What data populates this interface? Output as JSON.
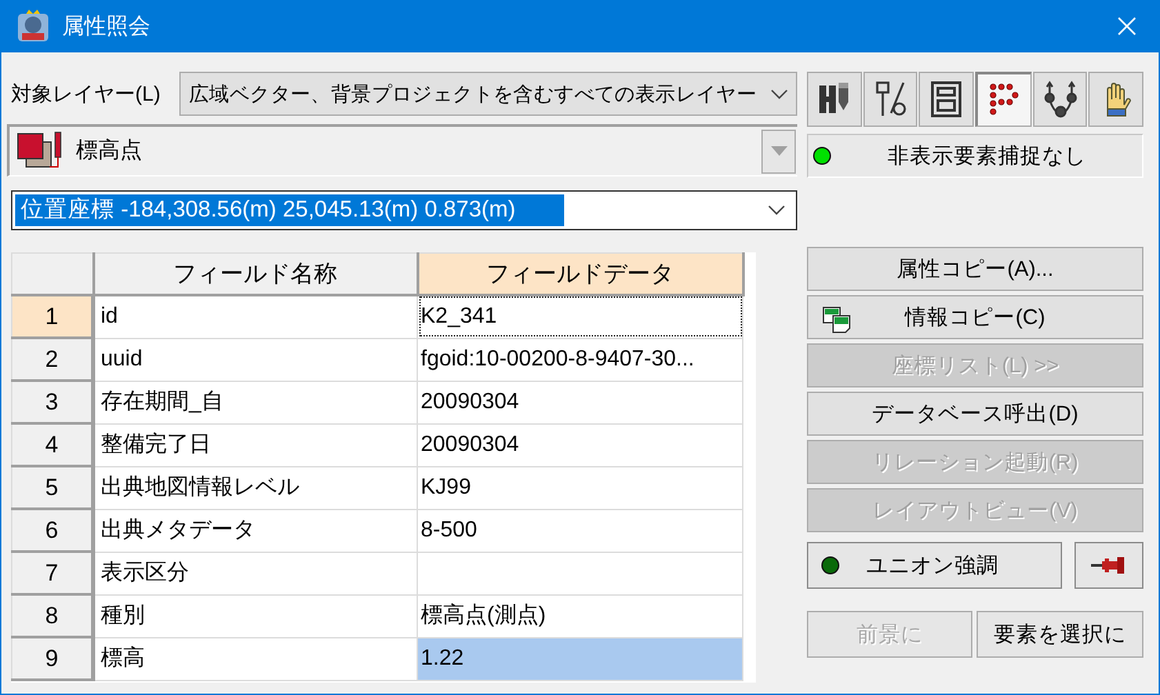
{
  "window": {
    "title": "属性照会"
  },
  "target_layer": {
    "label": "対象レイヤー(L)",
    "value": "広域ベクター、背景プロジェクトを含むすべての表示レイヤー"
  },
  "layer": {
    "name": "標高点",
    "dropdown_disabled": true
  },
  "position": {
    "value": "位置座標 -184,308.56(m) 25,045.13(m) 0.873(m)",
    "selected": true
  },
  "tools": [
    {
      "kind": "pencil",
      "selected": false
    },
    {
      "kind": "probe",
      "selected": false
    },
    {
      "kind": "frame",
      "selected": false
    },
    {
      "kind": "dots",
      "selected": true
    },
    {
      "kind": "nodes",
      "selected": false
    },
    {
      "kind": "hand",
      "selected": false
    }
  ],
  "hidden_capture": {
    "label": "非表示要素捕捉なし",
    "on": true
  },
  "table": {
    "columns": [
      {
        "label": "フィールド名称",
        "selected": false
      },
      {
        "label": "フィールドデータ",
        "selected": true
      }
    ],
    "rows": [
      {
        "number": "1",
        "name": "id",
        "value": "K2_341",
        "current": true,
        "selected": false
      },
      {
        "number": "2",
        "name": "uuid",
        "value": "fgoid:10-00200-8-9407-30...",
        "current": false,
        "selected": false
      },
      {
        "number": "3",
        "name": "存在期間_自",
        "value": "20090304",
        "current": false,
        "selected": false
      },
      {
        "number": "4",
        "name": "整備完了日",
        "value": "20090304",
        "current": false,
        "selected": false
      },
      {
        "number": "5",
        "name": "出典地図情報レベル",
        "value": "KJ99",
        "current": false,
        "selected": false
      },
      {
        "number": "6",
        "name": "出典メタデータ",
        "value": "8-500",
        "current": false,
        "selected": false
      },
      {
        "number": "7",
        "name": "表示区分",
        "current": false,
        "selected": false
      },
      {
        "number": "8",
        "name": "種別",
        "value": "標高点(測点)",
        "current": false,
        "selected": false
      },
      {
        "number": "9",
        "name": "標高",
        "value": "1.22",
        "current": false,
        "selected": true
      }
    ]
  },
  "actions": [
    {
      "label": "属性コピー(A)...",
      "kind": "plain",
      "disabled": false
    },
    {
      "label": "情報コピー(C)",
      "kind": "copy",
      "disabled": false
    },
    {
      "label": "座標リスト(L) >>",
      "kind": "plain",
      "disabled": true
    },
    {
      "label": "データベース呼出(D)",
      "kind": "plain",
      "disabled": false
    },
    {
      "label": "リレーション起動(R)",
      "kind": "plain",
      "disabled": true
    },
    {
      "label": "レイアウトビュー(V)",
      "kind": "plain",
      "disabled": true
    }
  ],
  "union": {
    "label": "ユニオン強調",
    "on": false
  },
  "bottom_buttons": [
    {
      "label": "前景に",
      "disabled": true
    },
    {
      "label": "要素を選択に",
      "disabled": false
    }
  ]
}
